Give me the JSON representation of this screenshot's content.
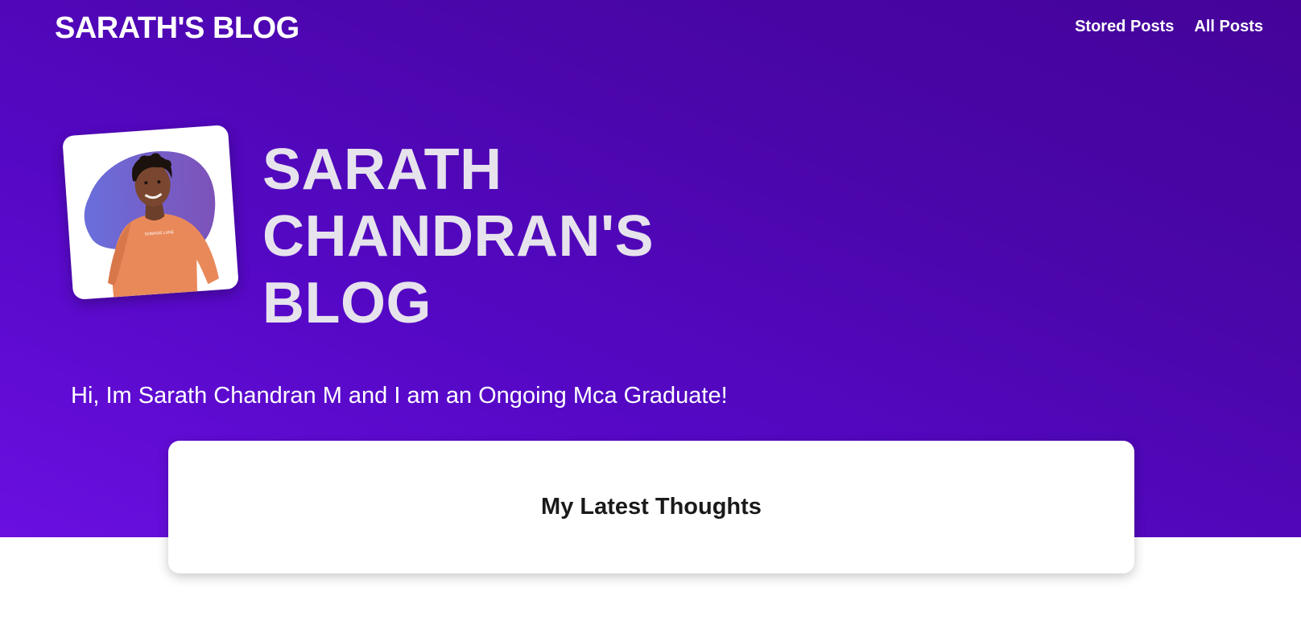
{
  "header": {
    "site_title": "SARATH'S BLOG",
    "nav": [
      {
        "label": "Stored Posts"
      },
      {
        "label": "All Posts"
      }
    ]
  },
  "hero": {
    "heading_lines": [
      "SARATH",
      "CHANDRAN'S",
      "BLOG"
    ],
    "intro": "Hi, Im Sarath Chandran M and I am an Ongoing Mca Graduate!",
    "avatar": "profile-photo",
    "shirt_text": "SOMAGE LANE"
  },
  "latest": {
    "title": "My Latest Thoughts"
  },
  "colors": {
    "hero_gradient_start": "#6a0fe0",
    "hero_gradient_end": "#45039a",
    "heading_text": "#e6e3ec",
    "card_bg": "#ffffff"
  }
}
